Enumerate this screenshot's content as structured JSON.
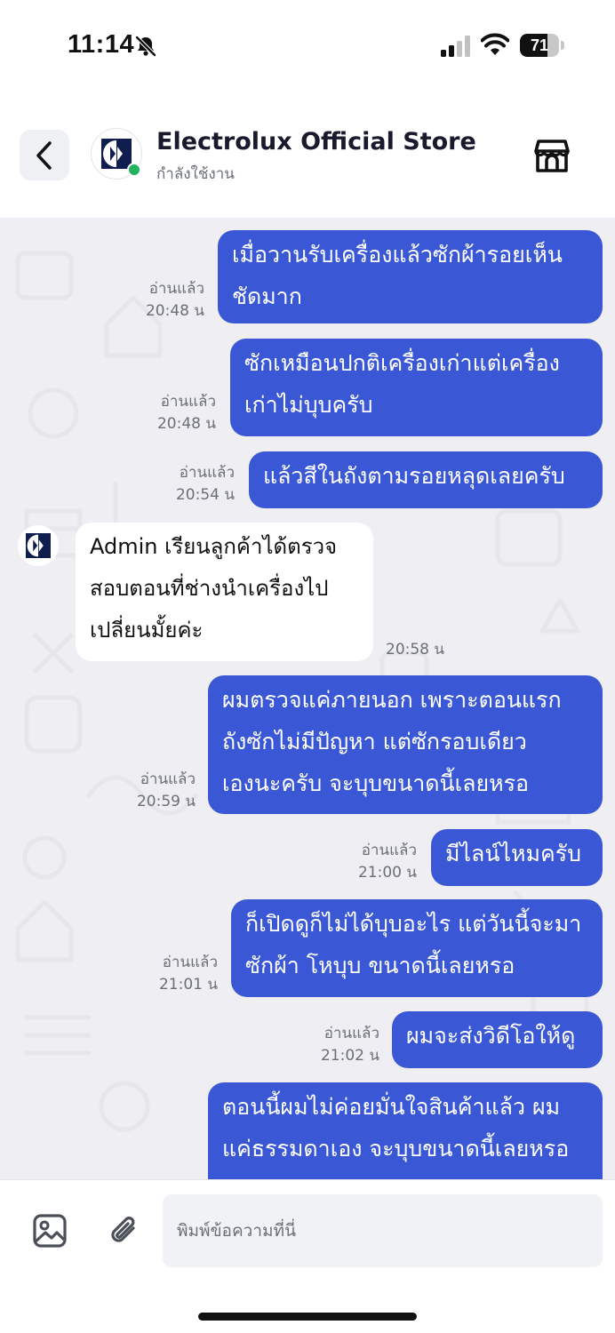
{
  "status_bar": {
    "time": "11:14",
    "battery_level": "71",
    "icons": [
      "bell-slash-icon",
      "cellular-signal-icon",
      "wifi-icon",
      "battery-icon"
    ]
  },
  "header": {
    "store_name": "Electrolux Official Store",
    "presence": "กำลังใช้งาน",
    "online": true,
    "icons": [
      "chevron-left-icon",
      "electrolux-logo",
      "storefront-icon"
    ]
  },
  "messages": [
    {
      "direction": "out",
      "lines": [
        "เมื่อวานรับเครื่องแล้วซักผ้ารอยเห็น",
        "ชัดมาก"
      ],
      "read": "อ่านแล้ว",
      "time": "20:48 น"
    },
    {
      "direction": "out",
      "lines": [
        "ซักเหมือนปกติเครื่องเก่าแต่เครื่อง",
        "เก่าไม่บุบครับ"
      ],
      "read": "อ่านแล้ว",
      "time": "20:48 น"
    },
    {
      "direction": "out",
      "lines": [
        "แล้วสีในถังตามรอยหลุดเลยครับ"
      ],
      "read": "อ่านแล้ว",
      "time": "20:54 น"
    },
    {
      "direction": "in",
      "lines": [
        "Admin เรียนลูกค้าได้ตรวจ",
        "สอบตอนที่ช่างนำเครื่องไป",
        "เปลี่ยนมั้ยค่ะ"
      ],
      "time": "20:58 น"
    },
    {
      "direction": "out",
      "lines": [
        "ผมตรวจแค่ภายนอก เพราะตอนแรก",
        "ถังซักไม่มีปัญหา  แต่ซักรอบเดียว",
        "เองนะครับ จะบุบขนาดนี้เลยหรอ"
      ],
      "read": "อ่านแล้ว",
      "time": "20:59 น"
    },
    {
      "direction": "out",
      "lines": [
        "มีไลน์ไหมครับ"
      ],
      "read": "อ่านแล้ว",
      "time": "21:00 น"
    },
    {
      "direction": "out",
      "lines": [
        "ก็เปิดดูก็ไม่ได้บุบอะไร แต่วันนี้จะมา",
        "ซักผ้า โหบุบ ขนาดนี้เลยหรอ"
      ],
      "read": "อ่านแล้ว",
      "time": "21:01 น"
    },
    {
      "direction": "out",
      "lines": [
        "ผมจะส่งวิดีโอให้ดู"
      ],
      "read": "อ่านแล้ว",
      "time": "21:02 น"
    },
    {
      "direction": "out",
      "lines": [
        "ตอนนี้ผมไม่ค่อยมั่นใจสินค้าแล้ว ผม",
        "แค่ธรรมดาเอง จะบุบขนาดนี้เลยหรอ"
      ]
    }
  ],
  "composer": {
    "placeholder": "พิมพ์ข้อความที่นี่",
    "icons": [
      "image-icon",
      "paperclip-icon"
    ]
  },
  "colors": {
    "outgoing_bubble": "#3a57d5",
    "incoming_bubble": "#ffffff",
    "chat_background": "#efeff3",
    "online": "#22b35e"
  }
}
